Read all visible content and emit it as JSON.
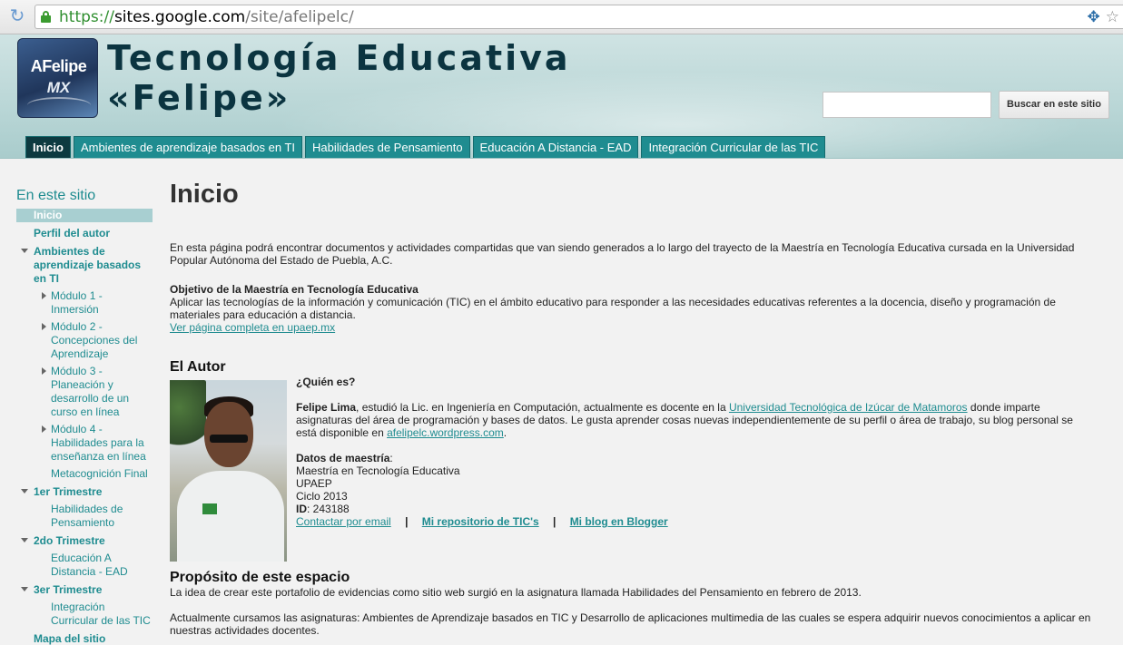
{
  "browser": {
    "url_scheme": "https://",
    "url_host": "sites.google.com",
    "url_path": "/site/afelipelc/"
  },
  "header": {
    "logo_line1": "AFelipe",
    "logo_line2": "MX",
    "title_line1": "Tecnología Educativa",
    "title_line2": "«Felipe»",
    "search_placeholder": "",
    "search_button": "Buscar en este sitio"
  },
  "tabs": [
    {
      "label": "Inicio",
      "active": true
    },
    {
      "label": "Ambientes de aprendizaje basados en TI"
    },
    {
      "label": "Habilidades de Pensamiento"
    },
    {
      "label": "Educación A Distancia - EAD"
    },
    {
      "label": "Integración Curricular de las TIC"
    }
  ],
  "sidebar": {
    "title": "En este sitio",
    "items": {
      "inicio": "Inicio",
      "perfil": "Perfil del autor",
      "ambientes": "Ambientes de aprendizaje basados en TI",
      "modulo1": "Módulo 1 - Inmersión",
      "modulo2": "Módulo 2 - Concepciones del Aprendizaje",
      "modulo3": "Módulo 3 - Planeación y desarrollo de un curso en línea",
      "modulo4": "Módulo 4 - Habilidades para la enseñanza en línea",
      "metacognicion": "Metacognición Final",
      "trim1": "1er Trimestre",
      "habilidades": "Habilidades de Pensamiento",
      "trim2": "2do Trimestre",
      "ead": "Educación A Distancia - EAD",
      "trim3": "3er Trimestre",
      "integracion": "Integración Curricular de las TIC",
      "mapa": "Mapa del sitio"
    }
  },
  "main": {
    "page_title": "Inicio",
    "intro": "En esta página podrá encontrar documentos y actividades compartidas que van siendo generados a lo largo del trayecto de la Maestría en Tecnología Educativa cursada en la Universidad Popular Autónoma del Estado de Puebla, A.C.",
    "objective_heading": "Objetivo de la Maestría en Tecnología Educativa",
    "objective_text": "Aplicar las tecnologías de la información y comunicación (TIC) en el ámbito educativo para responder a las necesidades educativas referentes a la docencia, diseño y programación de materiales para educación a distancia.",
    "objective_link": "Ver página completa en upaep.mx",
    "author_heading": "El Autor",
    "who_heading": "¿Quién es?",
    "author_name": "Felipe Lima",
    "bio_part1": ", estudió la Lic. en Ingeniería en Computación, actualmente es docente en la ",
    "bio_link1": "Universidad Tecnológica de Izúcar de Matamoros",
    "bio_part2": " donde imparte asignaturas del área de programación y bases de datos. Le gusta aprender cosas nuevas independientemente de su perfil o área de trabajo, su blog personal se está disponible en ",
    "bio_link2": "afelipelc.wordpress.com",
    "bio_part3": ".",
    "datos_heading": "Datos de maestría",
    "datos_colon": ":",
    "datos_line1": "Maestría en Tecnología Educativa",
    "datos_line2": "UPAEP",
    "datos_line3": "Ciclo 2013",
    "id_label": "ID",
    "id_value": ": 243188",
    "contact_link": "Contactar por email",
    "sep": "|",
    "repo_link": "Mi repositorio de TIC's",
    "blog_link": "Mi blog en Blogger",
    "purpose_heading": "Propósito de este espacio",
    "purpose_text1": "La idea de crear este portafolio de evidencias como sitio web surgió en la asignatura llamada Habilidades del Pensamiento en febrero de 2013.",
    "purpose_text2": "Actualmente cursamos las asignaturas: Ambientes de Aprendizaje basados en TIC  y Desarrollo de aplicaciones multimedia de las cuales se espera adquirir nuevos conocimientos a aplicar en nuestras actividades docentes."
  }
}
